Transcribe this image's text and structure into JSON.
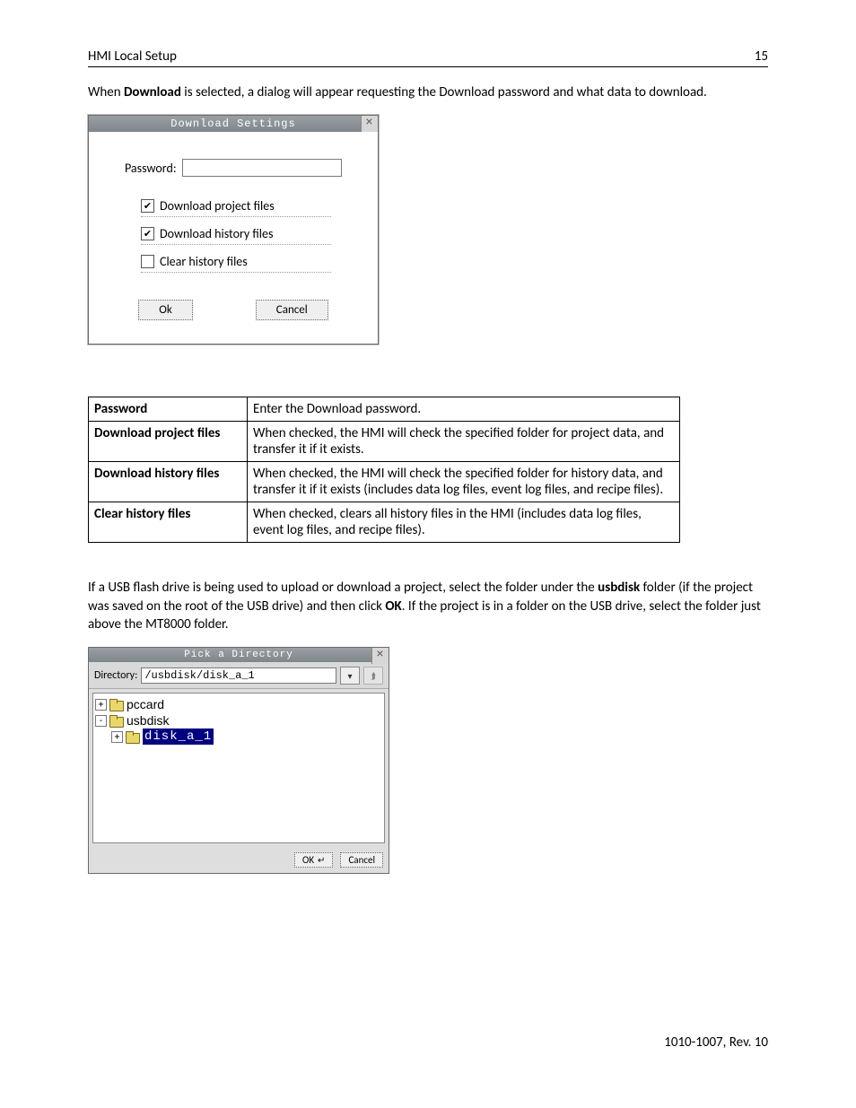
{
  "header": {
    "title": "HMI Local Setup",
    "page": "15"
  },
  "intro": {
    "pre": "When ",
    "bold1": "Download",
    "post": " is selected, a dialog will appear requesting the Download password and what data to download."
  },
  "dlg1": {
    "title": "Download Settings",
    "password_label": "Password:",
    "password_value": "",
    "options": [
      {
        "label": "Download project files",
        "checked": true
      },
      {
        "label": "Download history files",
        "checked": true
      },
      {
        "label": "Clear history files",
        "checked": false
      }
    ],
    "ok": "Ok",
    "cancel": "Cancel"
  },
  "table": {
    "rows": [
      {
        "k": "Password",
        "v": "Enter the Download password."
      },
      {
        "k": "Download project files",
        "v": "When checked, the HMI will check the specified folder for project data, and transfer it if it exists."
      },
      {
        "k": "Download history files",
        "v": "When checked, the HMI will check the specified folder for history data, and transfer it if it exists (includes data log files, event log files, and recipe files)."
      },
      {
        "k": "Clear history files",
        "v": "When checked, clears all history files in the HMI (includes data log files, event log files, and recipe files)."
      }
    ]
  },
  "para2": {
    "t1": "If a USB flash drive is being used to upload or download a project, select the folder under the ",
    "b1": "usbdisk",
    "t2": " folder (if the project was saved on the root of the USB drive) and then click ",
    "b2": "OK",
    "t3": ". If the project is in a folder on the USB drive, select the folder just above the MT8000 folder."
  },
  "dlg2": {
    "title": "Pick a Directory",
    "directory_label": "Directory:",
    "directory_value": "/usbdisk/disk_a_1",
    "tree": [
      {
        "indent": 0,
        "expander": "+",
        "label": "pccard",
        "selected": false
      },
      {
        "indent": 0,
        "expander": "-",
        "label": "usbdisk",
        "selected": false
      },
      {
        "indent": 1,
        "expander": "+",
        "label": "disk_a_1",
        "selected": true
      }
    ],
    "ok": "OK",
    "cancel": "Cancel"
  },
  "footer": "1010-1007, Rev. 10"
}
